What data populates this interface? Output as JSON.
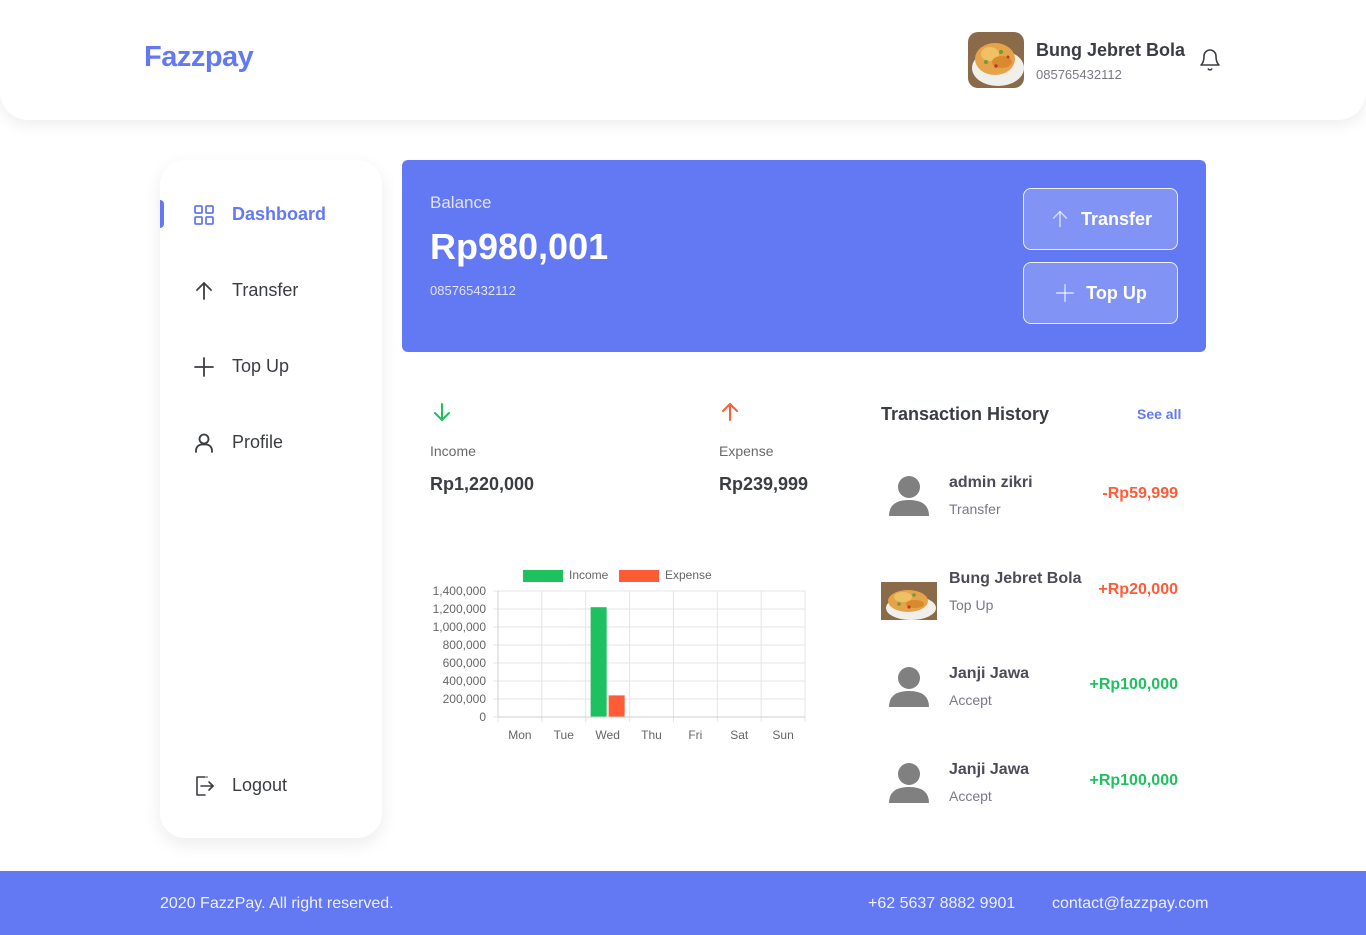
{
  "header": {
    "logo": "Fazzpay",
    "user_name": "Bung Jebret Bola",
    "user_phone": "085765432112"
  },
  "sidebar": {
    "items": [
      {
        "label": "Dashboard",
        "icon": "grid-icon",
        "active": true
      },
      {
        "label": "Transfer",
        "icon": "arrow-up-icon",
        "active": false
      },
      {
        "label": "Top Up",
        "icon": "plus-icon",
        "active": false
      },
      {
        "label": "Profile",
        "icon": "user-icon",
        "active": false
      }
    ],
    "logout_label": "Logout"
  },
  "balance": {
    "label": "Balance",
    "value": "Rp980,001",
    "phone": "085765432112",
    "transfer_label": "Transfer",
    "topup_label": "Top Up"
  },
  "stats": {
    "income_label": "Income",
    "income_value": "Rp1,220,000",
    "expense_label": "Expense",
    "expense_value": "Rp239,999"
  },
  "chart_data": {
    "type": "bar",
    "categories": [
      "Mon",
      "Tue",
      "Wed",
      "Thu",
      "Fri",
      "Sat",
      "Sun"
    ],
    "series": [
      {
        "name": "Income",
        "color": "#1ec15f",
        "values": [
          0,
          0,
          1220000,
          0,
          0,
          0,
          0
        ]
      },
      {
        "name": "Expense",
        "color": "#ff5b37",
        "values": [
          0,
          0,
          239999,
          0,
          0,
          0,
          0
        ]
      }
    ],
    "yticks": [
      "1,400,000",
      "1,200,000",
      "1,000,000",
      "800,000",
      "600,000",
      "400,000",
      "200,000",
      "0"
    ],
    "ylim": [
      0,
      1400000
    ],
    "legend": "top",
    "grid": true
  },
  "transactions": {
    "title": "Transaction History",
    "see_all": "See all",
    "items": [
      {
        "name": "admin zikri",
        "type": "Transfer",
        "amount": "-Rp59,999",
        "avatar": "default-user-avatar"
      },
      {
        "name": "Bung Jebret Bola",
        "type": "Top Up",
        "amount": "+Rp20,000",
        "avatar": "food-photo-avatar"
      },
      {
        "name": "Janji Jawa",
        "type": "Accept",
        "amount": "+Rp100,000",
        "avatar": "default-user-avatar"
      },
      {
        "name": "Janji Jawa",
        "type": "Accept",
        "amount": "+Rp100,000",
        "avatar": "default-user-avatar"
      }
    ]
  },
  "colors": {
    "primary": "#6379f4",
    "income": "#1ec15f",
    "expense": "#ff5b37",
    "negative_amount": "#ff5b37",
    "positive_amount_red": "#ff5b37",
    "positive_amount_green": "#1ec15f"
  },
  "footer": {
    "copyright": "2020 FazzPay. All right reserved.",
    "phone": "+62 5637 8882 9901",
    "email": "contact@fazzpay.com"
  }
}
